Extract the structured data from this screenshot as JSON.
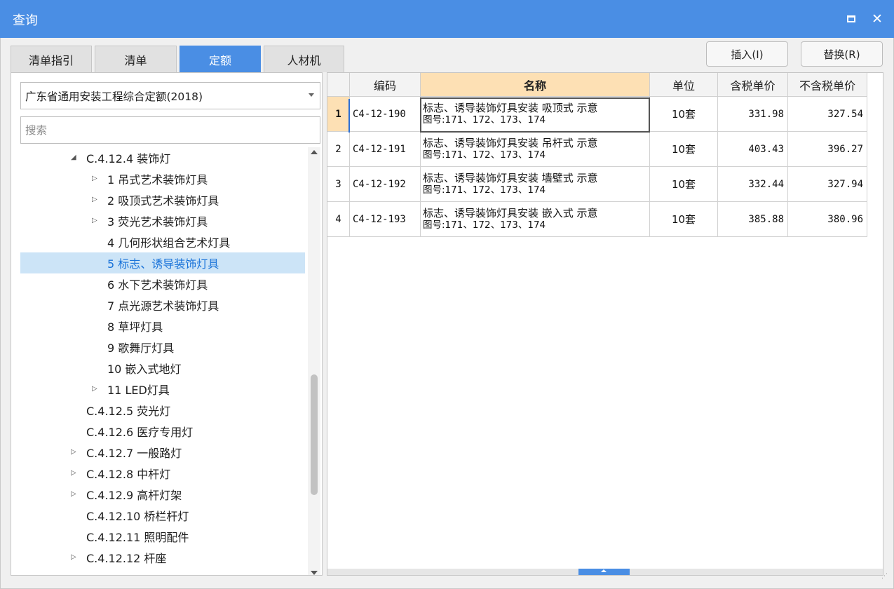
{
  "window": {
    "title": "查询",
    "maximize_icon": "maximize-icon",
    "close_icon": "close-icon",
    "close_glyph": "✕"
  },
  "tabs": [
    {
      "label": "清单指引",
      "active": false
    },
    {
      "label": "清单",
      "active": false
    },
    {
      "label": "定额",
      "active": true
    },
    {
      "label": "人材机",
      "active": false
    }
  ],
  "actions": {
    "insert_label": "插入(I)",
    "replace_label": "替换(R)"
  },
  "left": {
    "dropdown_value": "广东省通用安装工程综合定额(2018)",
    "search_placeholder": "搜索",
    "tree": [
      {
        "label": "C.4.12.4 装饰灯",
        "level": 2,
        "toggle": "expanded"
      },
      {
        "label": "1 吊式艺术装饰灯具",
        "level": 3,
        "toggle": "collapsed"
      },
      {
        "label": "2 吸顶式艺术装饰灯具",
        "level": 3,
        "toggle": "collapsed"
      },
      {
        "label": "3 荧光艺术装饰灯具",
        "level": 3,
        "toggle": "collapsed"
      },
      {
        "label": "4 几何形状组合艺术灯具",
        "level": 3,
        "toggle": "none"
      },
      {
        "label": "5 标志、诱导装饰灯具",
        "level": 3,
        "toggle": "none",
        "selected": true
      },
      {
        "label": "6 水下艺术装饰灯具",
        "level": 3,
        "toggle": "none"
      },
      {
        "label": "7 点光源艺术装饰灯具",
        "level": 3,
        "toggle": "none"
      },
      {
        "label": "8 草坪灯具",
        "level": 3,
        "toggle": "none"
      },
      {
        "label": "9 歌舞厅灯具",
        "level": 3,
        "toggle": "none"
      },
      {
        "label": "10 嵌入式地灯",
        "level": 3,
        "toggle": "none"
      },
      {
        "label": "11 LED灯具",
        "level": 3,
        "toggle": "collapsed"
      },
      {
        "label": "C.4.12.5 荧光灯",
        "level": 2,
        "toggle": "none"
      },
      {
        "label": "C.4.12.6 医疗专用灯",
        "level": 2,
        "toggle": "none"
      },
      {
        "label": "C.4.12.7 一般路灯",
        "level": 2,
        "toggle": "collapsed"
      },
      {
        "label": "C.4.12.8 中杆灯",
        "level": 2,
        "toggle": "collapsed"
      },
      {
        "label": "C.4.12.9 高杆灯架",
        "level": 2,
        "toggle": "collapsed"
      },
      {
        "label": "C.4.12.10 桥栏杆灯",
        "level": 2,
        "toggle": "none"
      },
      {
        "label": "C.4.12.11 照明配件",
        "level": 2,
        "toggle": "none"
      },
      {
        "label": "C.4.12.12 杆座",
        "level": 2,
        "toggle": "collapsed"
      }
    ],
    "scroll_icons": [
      "scroll-up-icon",
      "scroll-down-icon"
    ]
  },
  "grid": {
    "headers": [
      "编码",
      "名称",
      "单位",
      "含税单价",
      "不含税单价"
    ],
    "rows": [
      {
        "index": "1",
        "code": "C4-12-190",
        "name_line1": "标志、诱导装饰灯具安装 吸顶式 示意",
        "name_line2": "图号:171、172、173、174",
        "unit": "10套",
        "price_tax": "331.98",
        "price_notax": "327.54"
      },
      {
        "index": "2",
        "code": "C4-12-191",
        "name_line1": "标志、诱导装饰灯具安装 吊杆式 示意",
        "name_line2": "图号:171、172、173、174",
        "unit": "10套",
        "price_tax": "403.43",
        "price_notax": "396.27"
      },
      {
        "index": "3",
        "code": "C4-12-192",
        "name_line1": "标志、诱导装饰灯具安装 墙壁式 示意",
        "name_line2": "图号:171、172、173、174",
        "unit": "10套",
        "price_tax": "332.44",
        "price_notax": "327.94"
      },
      {
        "index": "4",
        "code": "C4-12-193",
        "name_line1": "标志、诱导装饰灯具安装 嵌入式 示意",
        "name_line2": "图号:171、172、173、174",
        "unit": "10套",
        "price_tax": "385.88",
        "price_notax": "380.96"
      }
    ],
    "active_row": 1
  }
}
